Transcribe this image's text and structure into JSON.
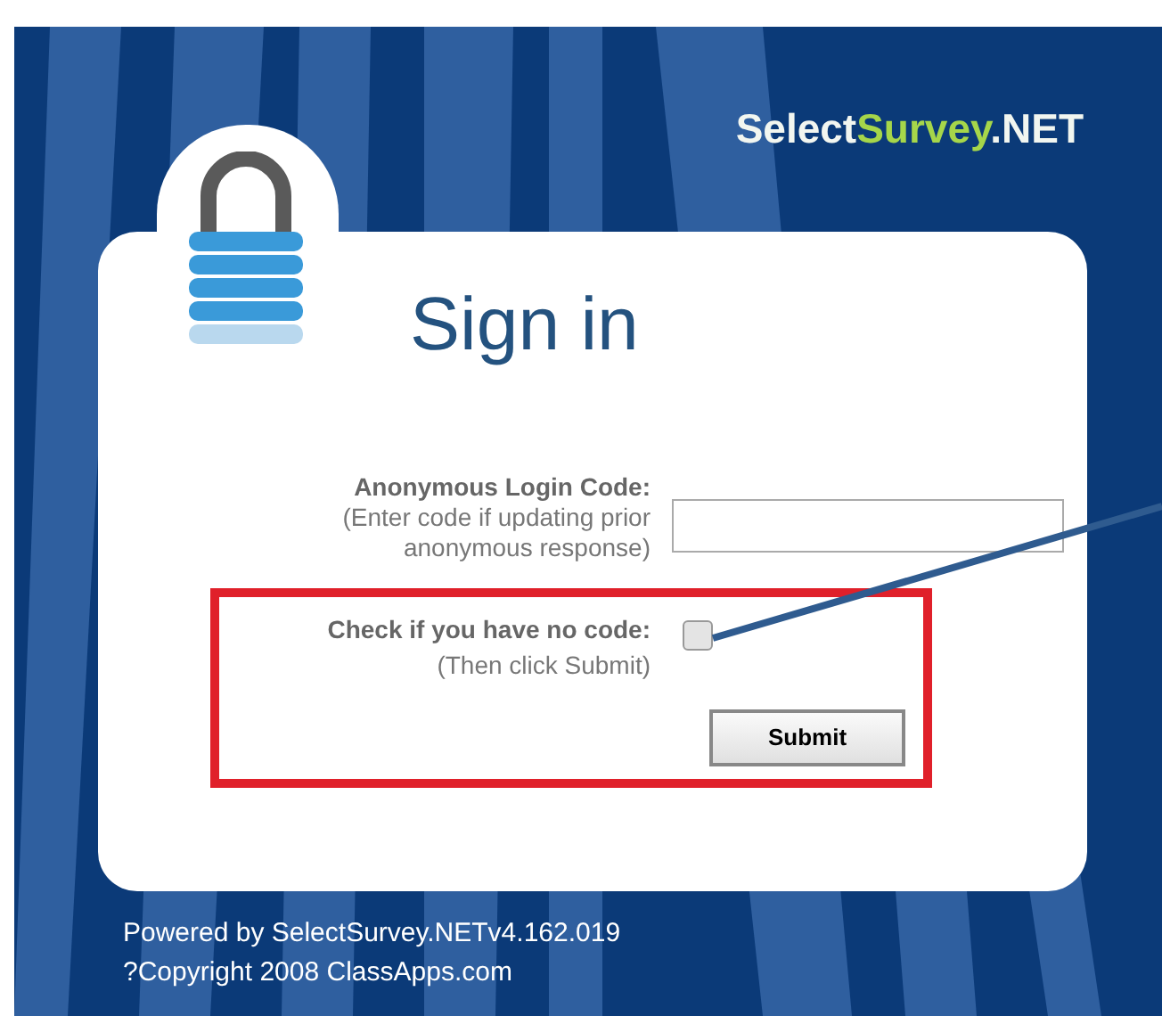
{
  "logo": [
    "Select",
    "Survey",
    ".NET"
  ],
  "heading": "Sign in",
  "login_code": {
    "label": "Anonymous Login Code:",
    "hint": "(Enter code if updating prior anonymous response)"
  },
  "no_code": {
    "label": "Check if you have no code:",
    "hint": "(Then click Submit)",
    "checked": false
  },
  "submit": "Submit",
  "footer": [
    "Powered by SelectSurvey.NETv4.162.019",
    "?Copyright 2008 ClassApps.com"
  ]
}
